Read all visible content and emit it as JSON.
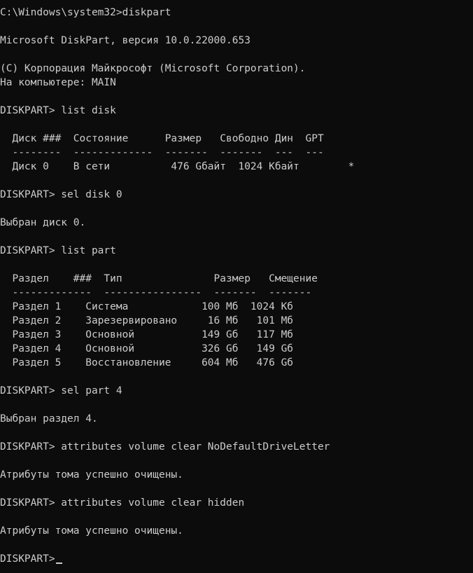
{
  "console": {
    "lines": [
      "C:\\Windows\\system32>diskpart",
      "",
      "Microsoft DiskPart, версия 10.0.22000.653",
      "",
      "(C) Корпорация Майкрософт (Microsoft Corporation).",
      "На компьютере: MAIN",
      "",
      "DISKPART> list disk",
      "",
      "  Диск ###  Состояние      Размер   Свободно Дин  GPT",
      "  --------  -------------  -------  -------  ---  ---",
      "  Диск 0    В сети          476 Gбайт  1024 Kбайт        *",
      "",
      "DISKPART> sel disk 0",
      "",
      "Выбран диск 0.",
      "",
      "DISKPART> list part",
      "",
      "  Раздел    ###  Тип               Размер   Смещение",
      "  -------------  ----------------  -------  -------",
      "  Раздел 1    Система            100 Мб  1024 Кб",
      "  Раздел 2    Зарезервировано     16 Мб   101 Мб",
      "  Раздел 3    Основной           149 Gб   117 Мб",
      "  Раздел 4    Основной           326 Gб   149 Gб",
      "  Раздел 5    Восстановление     604 Мб   476 Gб",
      "",
      "DISKPART> sel part 4",
      "",
      "Выбран раздел 4.",
      "",
      "DISKPART> attributes volume clear NoDefaultDriveLetter",
      "",
      "Атрибуты тома успешно очищены.",
      "",
      "DISKPART> attributes volume clear hidden",
      "",
      "Атрибуты тома успешно очищены.",
      "",
      "DISKPART>"
    ]
  }
}
